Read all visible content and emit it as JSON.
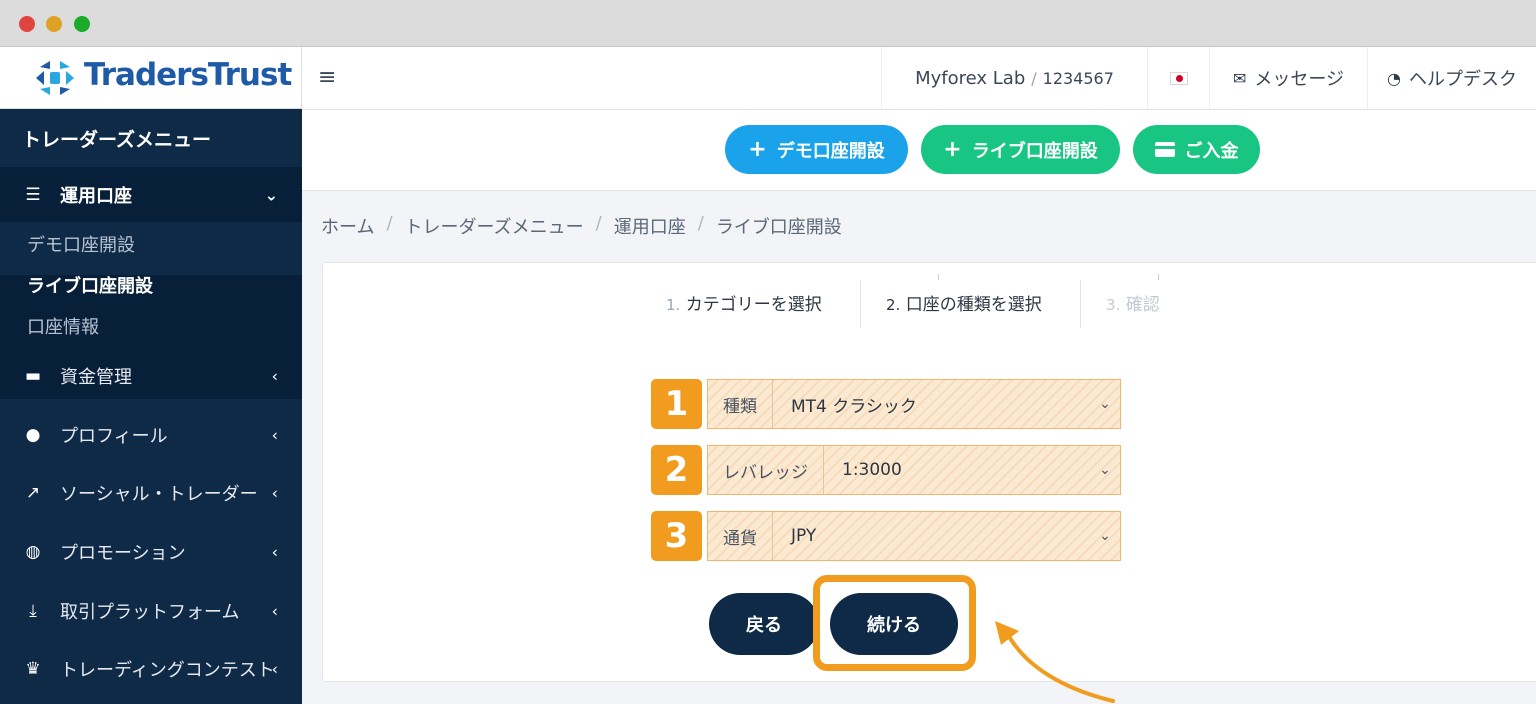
{
  "window": {
    "controls": [
      "close",
      "minimize",
      "maximize"
    ]
  },
  "brand": {
    "name": "TradersTrust",
    "color": "#1e5aa8"
  },
  "sidebar": {
    "title": "トレーダーズメニュー",
    "items": [
      {
        "label": "運用口座",
        "icon": "list-icon",
        "chevron": "⌄",
        "open": true
      },
      {
        "label": "資金管理",
        "icon": "wallet-icon",
        "chevron": "‹"
      },
      {
        "label": "プロフィール",
        "icon": "user-icon",
        "chevron": "‹"
      },
      {
        "label": "ソーシャル・トレーダー",
        "icon": "chart-icon",
        "chevron": "‹"
      },
      {
        "label": "プロモーション",
        "icon": "globe-icon",
        "chevron": "‹"
      },
      {
        "label": "取引プラットフォーム",
        "icon": "download-icon",
        "chevron": "‹"
      },
      {
        "label": "トレーディングコンテスト",
        "icon": "trophy-icon",
        "chevron": "‹"
      }
    ],
    "submenu": [
      {
        "label": "デモ口座開設",
        "active": false
      },
      {
        "label": "ライブ口座開設",
        "active": true
      },
      {
        "label": "口座情報",
        "active": false
      }
    ]
  },
  "topbar": {
    "account_name": "Myforex Lab",
    "account_separator": "/",
    "account_number": "1234567",
    "language_flag": "jp-flag",
    "messages_label": "メッセージ",
    "helpdesk_label": "ヘルプデスク"
  },
  "actions": {
    "demo_label": "デモ口座開設",
    "live_label": "ライブ口座開設",
    "deposit_label": "ご入金",
    "demo_color": "#1aa3ea",
    "live_color": "#19c583"
  },
  "breadcrumb": {
    "items": [
      "ホーム",
      "トレーダーズメニュー",
      "運用口座",
      "ライブ口座開設"
    ],
    "separator": "/"
  },
  "steps": [
    {
      "num": "1.",
      "label": "カテゴリーを選択"
    },
    {
      "num": "2.",
      "label": "口座の種類を選択"
    },
    {
      "num": "3.",
      "label": "確認"
    }
  ],
  "form": {
    "rows": [
      {
        "badge": "1",
        "label": "種類",
        "value": "MT4 クラシック"
      },
      {
        "badge": "2",
        "label": "レバレッジ",
        "value": "1:3000"
      },
      {
        "badge": "3",
        "label": "通貨",
        "value": "JPY"
      }
    ]
  },
  "buttons": {
    "back_label": "戻る",
    "continue_label": "続ける"
  },
  "highlight_color": "#f29c1f"
}
